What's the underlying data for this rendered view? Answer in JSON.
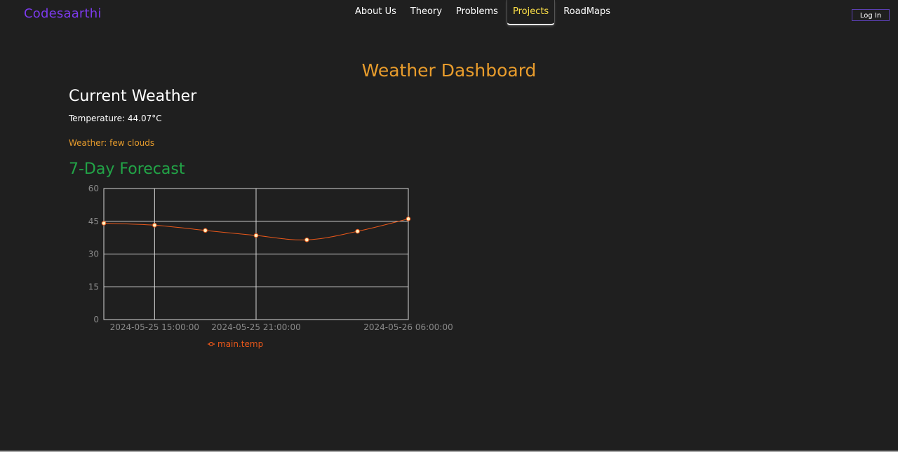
{
  "navbar": {
    "brand": "Codesaarthi",
    "links": [
      {
        "label": "About Us",
        "active": false
      },
      {
        "label": "Theory",
        "active": false
      },
      {
        "label": "Problems",
        "active": false
      },
      {
        "label": "Projects",
        "active": true
      },
      {
        "label": "RoadMaps",
        "active": false
      }
    ],
    "login_label": "Log In"
  },
  "page": {
    "title": "Weather Dashboard",
    "current_heading": "Current Weather",
    "temperature_text": "Temperature: 44.07°C",
    "weather_text": "Weather: few clouds",
    "forecast_heading": "7-Day Forecast"
  },
  "colors": {
    "brand": "#7c3aed",
    "accent": "#e89c2c",
    "forecast": "#22a447",
    "line": "#e8571a",
    "background": "#1f1f1f"
  },
  "chart_data": {
    "type": "line",
    "x": [
      "2024-05-25 12:00:00",
      "2024-05-25 15:00:00",
      "2024-05-25 18:00:00",
      "2024-05-25 21:00:00",
      "2024-05-26 00:00:00",
      "2024-05-26 03:00:00",
      "2024-05-26 06:00:00"
    ],
    "x_tick_labels": [
      "2024-05-25 15:00:00",
      "2024-05-25 21:00:00",
      "2024-05-26 06:00:00"
    ],
    "series": [
      {
        "name": "main.temp",
        "values": [
          44.1,
          43.2,
          40.8,
          38.5,
          36.5,
          40.4,
          46.1
        ]
      }
    ],
    "ylim": [
      0,
      60
    ],
    "y_ticks": [
      0,
      15,
      30,
      45,
      60
    ],
    "grid": true,
    "legend": "bottom"
  }
}
